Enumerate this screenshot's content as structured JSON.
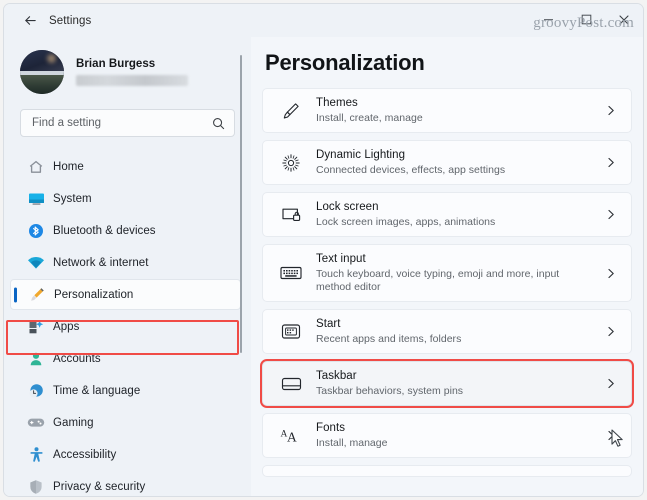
{
  "window": {
    "title": "Settings",
    "back_icon": "back-arrow-icon",
    "minimize_label": "Minimize",
    "maximize_label": "Maximize",
    "close_label": "Close",
    "watermark": "groovyPost.com"
  },
  "account": {
    "name": "Brian Burgess",
    "email_redacted": "",
    "avatar_icon": "user-avatar-photo"
  },
  "search": {
    "placeholder": "Find a setting",
    "value": "",
    "icon": "search-icon"
  },
  "sidebar": {
    "items": [
      {
        "label": "Home",
        "icon": "home-icon",
        "selected": false
      },
      {
        "label": "System",
        "icon": "system-icon",
        "selected": false
      },
      {
        "label": "Bluetooth & devices",
        "icon": "bluetooth-icon",
        "selected": false
      },
      {
        "label": "Network & internet",
        "icon": "network-icon",
        "selected": false
      },
      {
        "label": "Personalization",
        "icon": "paintbrush-icon",
        "selected": true
      },
      {
        "label": "Apps",
        "icon": "apps-icon",
        "selected": false
      },
      {
        "label": "Accounts",
        "icon": "accounts-icon",
        "selected": false
      },
      {
        "label": "Time & language",
        "icon": "clock-icon",
        "selected": false
      },
      {
        "label": "Gaming",
        "icon": "gamepad-icon",
        "selected": false
      },
      {
        "label": "Accessibility",
        "icon": "accessibility-icon",
        "selected": false
      },
      {
        "label": "Privacy & security",
        "icon": "shield-icon",
        "selected": false
      }
    ]
  },
  "main": {
    "page_title": "Personalization",
    "rows": [
      {
        "title": "Themes",
        "subtitle": "Install, create, manage",
        "icon": "paintbrush-icon",
        "highlighted": false
      },
      {
        "title": "Dynamic Lighting",
        "subtitle": "Connected devices, effects, app settings",
        "icon": "sunburst-icon",
        "highlighted": false
      },
      {
        "title": "Lock screen",
        "subtitle": "Lock screen images, apps, animations",
        "icon": "lock-screen-icon",
        "highlighted": false
      },
      {
        "title": "Text input",
        "subtitle": "Touch keyboard, voice typing, emoji and more, input method editor",
        "icon": "keyboard-icon",
        "highlighted": false
      },
      {
        "title": "Start",
        "subtitle": "Recent apps and items, folders",
        "icon": "start-menu-icon",
        "highlighted": false
      },
      {
        "title": "Taskbar",
        "subtitle": "Taskbar behaviors, system pins",
        "icon": "taskbar-icon",
        "highlighted": true
      },
      {
        "title": "Fonts",
        "subtitle": "Install, manage",
        "icon": "fonts-icon",
        "highlighted": false
      }
    ]
  },
  "colors": {
    "accent_blue": "#0a65c4",
    "annotation_red": "#f04b46",
    "sidebar_bg": "#eef2f7",
    "content_bg": "#f3f6fa",
    "card_bg": "#fbfcfe"
  }
}
